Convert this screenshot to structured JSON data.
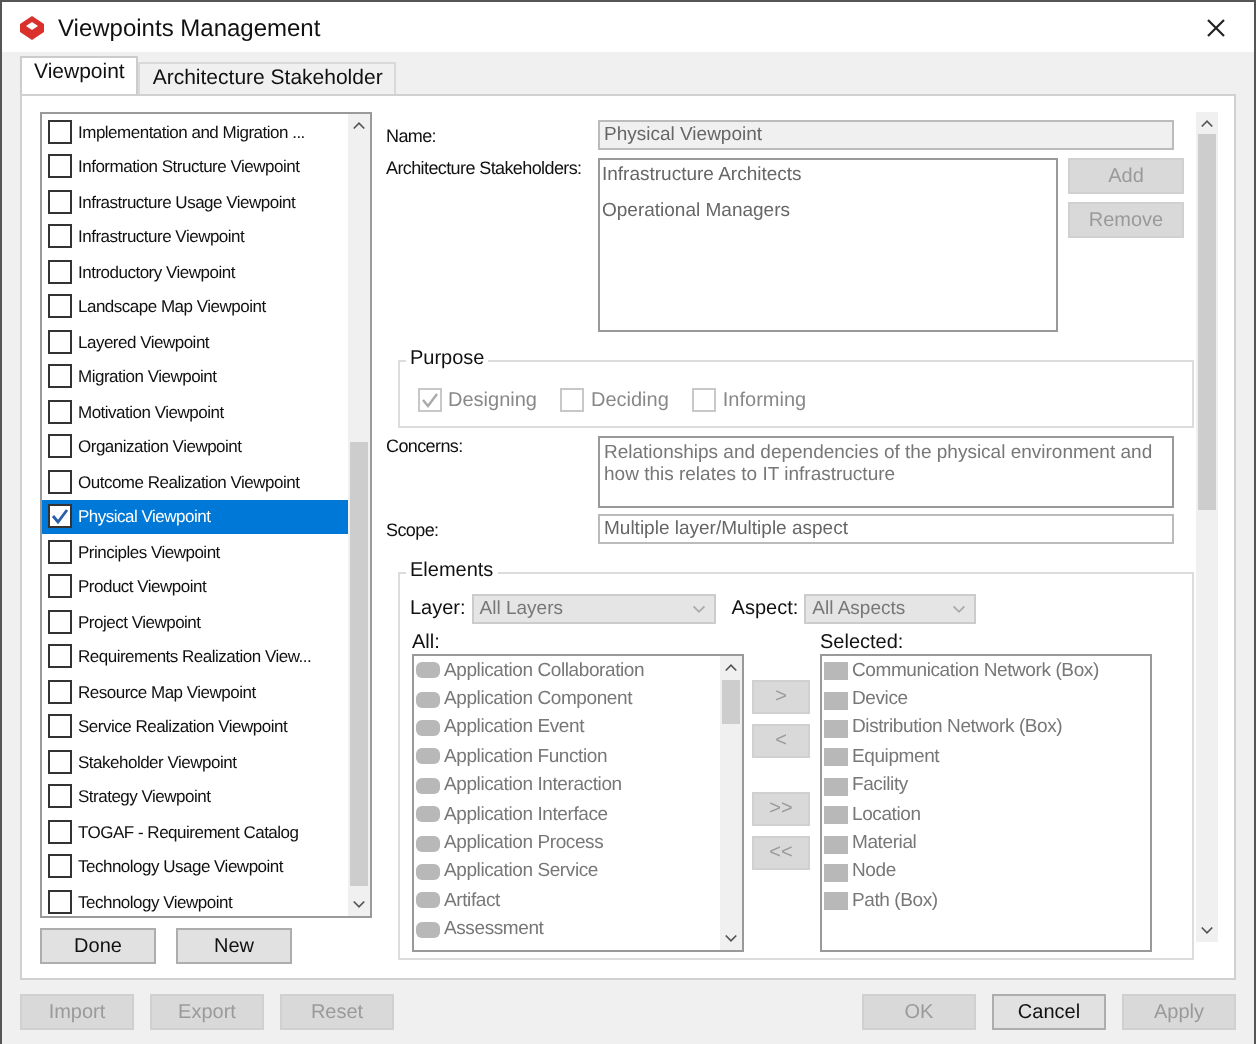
{
  "window": {
    "title": "Viewpoints Management"
  },
  "tabs": [
    {
      "label": "Viewpoint",
      "selected": true
    },
    {
      "label": "Architecture Stakeholder",
      "selected": false
    }
  ],
  "viewpoints": [
    {
      "label": "Implementation and Migration ...",
      "checked": false,
      "selected": false
    },
    {
      "label": "Information Structure Viewpoint",
      "checked": false,
      "selected": false
    },
    {
      "label": "Infrastructure Usage Viewpoint",
      "checked": false,
      "selected": false
    },
    {
      "label": "Infrastructure Viewpoint",
      "checked": false,
      "selected": false
    },
    {
      "label": "Introductory Viewpoint",
      "checked": false,
      "selected": false
    },
    {
      "label": "Landscape Map Viewpoint",
      "checked": false,
      "selected": false
    },
    {
      "label": "Layered Viewpoint",
      "checked": false,
      "selected": false
    },
    {
      "label": "Migration Viewpoint",
      "checked": false,
      "selected": false
    },
    {
      "label": "Motivation Viewpoint",
      "checked": false,
      "selected": false
    },
    {
      "label": "Organization Viewpoint",
      "checked": false,
      "selected": false
    },
    {
      "label": "Outcome Realization Viewpoint",
      "checked": false,
      "selected": false
    },
    {
      "label": "Physical Viewpoint",
      "checked": true,
      "selected": true
    },
    {
      "label": "Principles Viewpoint",
      "checked": false,
      "selected": false
    },
    {
      "label": "Product Viewpoint",
      "checked": false,
      "selected": false
    },
    {
      "label": "Project Viewpoint",
      "checked": false,
      "selected": false
    },
    {
      "label": "Requirements Realization View...",
      "checked": false,
      "selected": false
    },
    {
      "label": "Resource Map Viewpoint",
      "checked": false,
      "selected": false
    },
    {
      "label": "Service Realization Viewpoint",
      "checked": false,
      "selected": false
    },
    {
      "label": "Stakeholder Viewpoint",
      "checked": false,
      "selected": false
    },
    {
      "label": "Strategy Viewpoint",
      "checked": false,
      "selected": false
    },
    {
      "label": "TOGAF - Requirement Catalog",
      "checked": false,
      "selected": false
    },
    {
      "label": "Technology Usage Viewpoint",
      "checked": false,
      "selected": false
    },
    {
      "label": "Technology Viewpoint",
      "checked": false,
      "selected": false
    }
  ],
  "list_buttons": [
    {
      "label": "Done",
      "disabled": false
    },
    {
      "label": "New",
      "disabled": false
    }
  ],
  "name": {
    "label": "Name:",
    "value": "Physical Viewpoint"
  },
  "stakeholders": {
    "label": "Architecture Stakeholders:",
    "items": [
      "Infrastructure Architects",
      "Operational Managers"
    ],
    "buttons": [
      {
        "label": "Add",
        "disabled": true
      },
      {
        "label": "Remove",
        "disabled": true
      }
    ]
  },
  "purpose": {
    "title": "Purpose",
    "options": [
      {
        "label": "Designing",
        "checked": true
      },
      {
        "label": "Deciding",
        "checked": false
      },
      {
        "label": "Informing",
        "checked": false
      }
    ]
  },
  "concerns": {
    "label": "Concerns:",
    "value": "Relationships and dependencies of the physical environment and how this relates to IT infrastructure"
  },
  "scope": {
    "label": "Scope:",
    "value": "Multiple layer/Multiple aspect"
  },
  "elements": {
    "title": "Elements",
    "layer": {
      "label": "Layer:",
      "value": "All Layers"
    },
    "aspect": {
      "label": "Aspect:",
      "value": "All Aspects"
    },
    "all_label": "All:",
    "all": [
      "Application Collaboration",
      "Application Component",
      "Application Event",
      "Application Function",
      "Application Interaction",
      "Application Interface",
      "Application Process",
      "Application Service",
      "Artifact",
      "Assessment"
    ],
    "move_buttons": [
      {
        "label": ">",
        "disabled": true
      },
      {
        "label": "<",
        "disabled": true
      },
      {
        "label": ">>",
        "disabled": true
      },
      {
        "label": "<<",
        "disabled": true
      }
    ],
    "selected_label": "Selected:",
    "selected": [
      "Communication Network (Box)",
      "Device",
      "Distribution Network (Box)",
      "Equipment",
      "Facility",
      "Location",
      "Material",
      "Node",
      "Path (Box)"
    ]
  },
  "footer_left": [
    {
      "label": "Import",
      "disabled": true
    },
    {
      "label": "Export",
      "disabled": true
    },
    {
      "label": "Reset",
      "disabled": true
    }
  ],
  "footer_right": [
    {
      "label": "OK",
      "disabled": true
    },
    {
      "label": "Cancel",
      "disabled": false
    },
    {
      "label": "Apply",
      "disabled": true
    }
  ]
}
